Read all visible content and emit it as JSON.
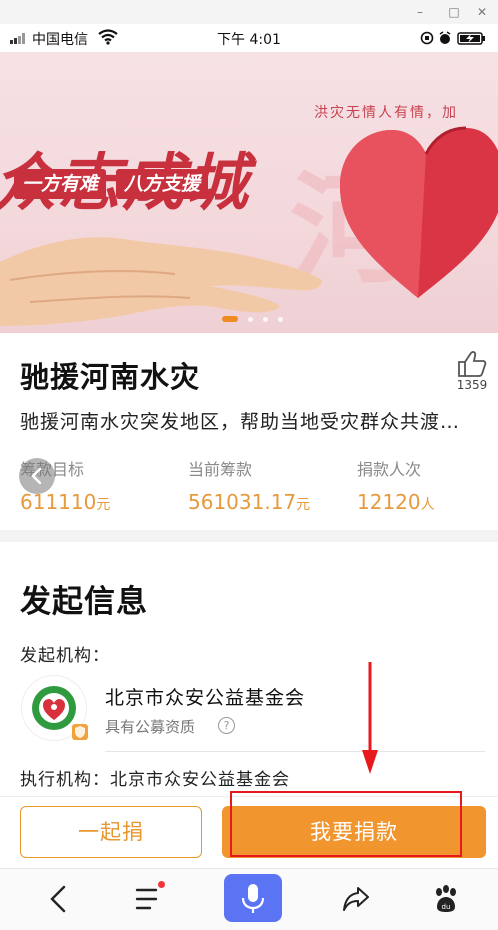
{
  "window": {
    "minimize": "–",
    "maximize": "□",
    "close": "✕"
  },
  "status_bar": {
    "carrier": "中国电信",
    "time": "下午 4:01"
  },
  "banner": {
    "title": "众志成城",
    "slogan": "洪灾无情人有情，加",
    "tag_left": "一方有难",
    "tag_right": "八方支援",
    "bg_char": "河",
    "slide_count": 4,
    "active_slide": 0
  },
  "project": {
    "title": "驰援河南水灾",
    "likes": "1359",
    "description": "驰援河南水灾突发地区，帮助当地受灾群众共渡…",
    "stats": [
      {
        "label": "筹款目标",
        "value": "611110",
        "unit": "元"
      },
      {
        "label": "当前筹款",
        "value": "561031.17",
        "unit": "元"
      },
      {
        "label": "捐款人次",
        "value": "12120",
        "unit": "人"
      }
    ]
  },
  "initiator": {
    "section_title": "发起信息",
    "org_label": "发起机构：",
    "org_name": "北京市众安公益基金会",
    "org_qualification": "具有公募资质",
    "exec_label": "执行机构：",
    "exec_name": "北京市众安公益基金会"
  },
  "actions": {
    "together": "一起捐",
    "donate": "我要捐款"
  },
  "colors": {
    "accent": "#f1952f",
    "brand_red": "#c8303d",
    "annotation": "#e8191c",
    "voice": "#5b74f3"
  },
  "toolbar_icons": [
    "back-icon",
    "menu-icon",
    "mic-icon",
    "share-icon",
    "paw-icon"
  ]
}
